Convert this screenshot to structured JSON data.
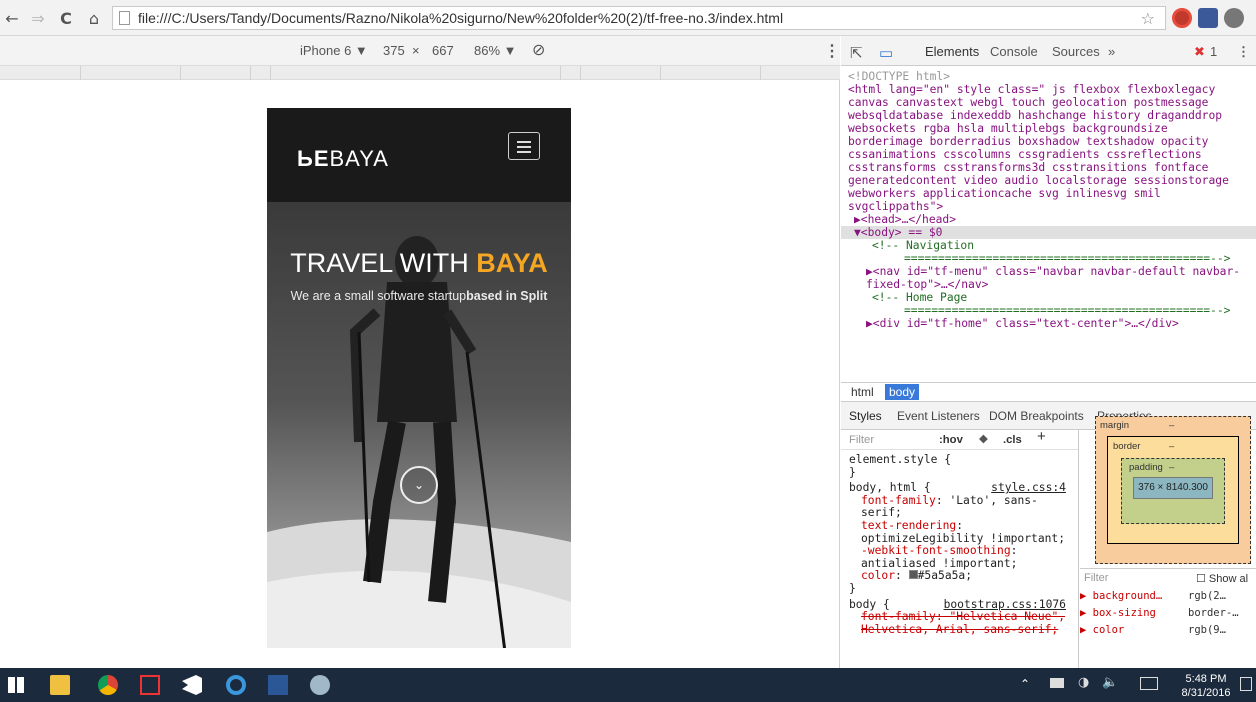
{
  "browser": {
    "url": "file:///C:/Users/Tandy/Documents/Razno/Nikola%20sigurno/New%20folder%20(2)/tf-free-no.3/index.html"
  },
  "device_toolbar": {
    "device": "iPhone 6 ▼",
    "width": "375",
    "times": "×",
    "height": "667",
    "zoom": "86% ▼"
  },
  "site": {
    "logo": "BAYA",
    "title_prefix": "TRAVEL WITH ",
    "title_accent": "BAYA",
    "subtitle_prefix": "We are a small software startup",
    "subtitle_bold": "based in Split"
  },
  "devtools": {
    "tabs": [
      "Elements",
      "Console",
      "Sources",
      "»"
    ],
    "error_count": "1",
    "dom_lines": [
      "<!DOCTYPE html>",
      "<html lang=\"en\" style class=\" js flexbox flexboxlegacy canvas canvastext webgl touch geolocation postmessage websqldatabase indexeddb hashchange history draganddrop websockets rgba hsla multiplebgs backgroundsize borderimage borderradius boxshadow textshadow opacity cssanimations csscolumns cssgradients cssreflections csstransforms csstransforms3d csstransitions fontface generatedcontent video audio localstorage sessionstorage webworkers applicationcache svg inlinesvg smil svgclippaths\">",
      "▶<head>…</head>",
      "▼<body> == $0",
      "<!-- Navigation",
      "=============================================-->",
      "▶<nav id=\"tf-menu\" class=\"navbar navbar-default navbar-fixed-top\">…</nav>",
      "<!-- Home Page",
      "=============================================-->",
      "▶<div id=\"tf-home\" class=\"text-center\">…</div>"
    ],
    "breadcrumb": [
      "html",
      "body"
    ],
    "style_tabs": [
      "Styles",
      "Event Listeners",
      "DOM Breakpoints",
      "Properties"
    ],
    "filter_placeholder": "Filter",
    "hov": ":hov",
    "cls": ".cls",
    "plus": "+",
    "rules": [
      {
        "selector": "element.style {",
        "source": ""
      },
      {
        "selector": "body, html {",
        "source": "style.css:4"
      },
      {
        "selector": "body {",
        "source": "bootstrap.css:1076"
      }
    ],
    "decls": [
      {
        "name": "font-family",
        "value": "'Lato', sans-serif;"
      },
      {
        "name": "text-rendering",
        "value": "optimizeLegibility !important;"
      },
      {
        "name": "-webkit-font-smoothing",
        "value": "antialiased !important;"
      },
      {
        "name": "color",
        "value": "#5a5a5a;"
      },
      {
        "name": "font-family",
        "value": "\"Helvetica Neue\", Helvetica, Arial, sans-serif;"
      }
    ],
    "box_model": {
      "margin": "margin",
      "border": "border",
      "padding": "padding",
      "dash": "–",
      "content": "376 × 8140.300"
    },
    "computed_filter": "Filter",
    "show_all": "Show al",
    "computed": [
      {
        "name": "▶ background…",
        "value": "rgb(2…"
      },
      {
        "name": "▶ box-sizing",
        "value": "border-…"
      },
      {
        "name": "▶ color",
        "value": "rgb(9…"
      }
    ]
  },
  "taskbar": {
    "time": "5:48 PM",
    "date": "8/31/2016"
  }
}
